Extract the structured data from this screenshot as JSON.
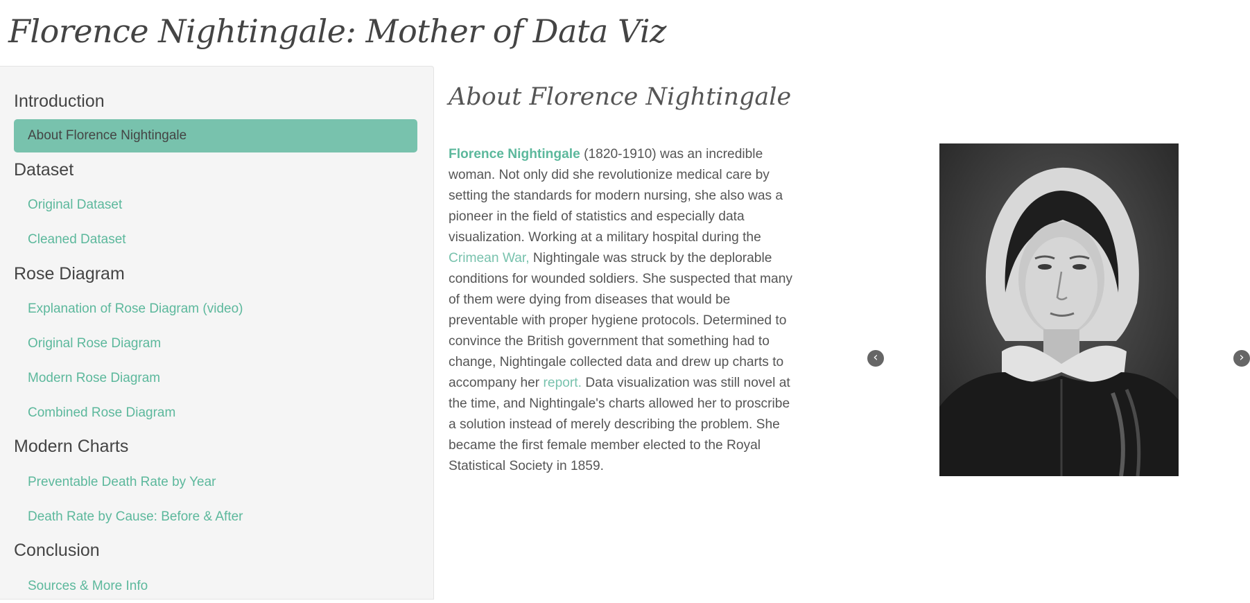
{
  "app_title": "Florence Nightingale: Mother of Data Viz",
  "sidebar": {
    "sections": [
      {
        "header": "Introduction",
        "items": [
          {
            "label": "About Florence Nightingale",
            "active": true
          }
        ]
      },
      {
        "header": "Dataset",
        "items": [
          {
            "label": "Original Dataset"
          },
          {
            "label": "Cleaned Dataset"
          }
        ]
      },
      {
        "header": "Rose Diagram",
        "items": [
          {
            "label": "Explanation of Rose Diagram (video)"
          },
          {
            "label": "Original Rose Diagram"
          },
          {
            "label": "Modern Rose Diagram"
          },
          {
            "label": "Combined Rose Diagram"
          }
        ]
      },
      {
        "header": "Modern Charts",
        "items": [
          {
            "label": "Preventable Death Rate by Year"
          },
          {
            "label": "Death Rate by Cause: Before & After"
          }
        ]
      },
      {
        "header": "Conclusion",
        "items": [
          {
            "label": "Sources & More Info"
          }
        ]
      }
    ]
  },
  "main": {
    "title": "About Florence Nightingale",
    "bio": {
      "link_name": "Florence Nightingale",
      "text1": " (1820-1910) was an incredible woman. Not only did she revolutionize medical care by setting the standards for modern nursing, she also was a pioneer in the field of statistics and especially data visualization. Working at a military hospital during the ",
      "link_war": "Crimean War,",
      "text2": " Nightingale was struck by the deplorable conditions for wounded soldiers. She suspected that many of them were dying from diseases that would be preventable with proper hygiene protocols. Determined to convince the British government that something had to change, Nightingale collected data and drew up charts to accompany her ",
      "link_report": "report.",
      "text3": " Data visualization was still novel at the time, and Nightingale's charts allowed her to proscribe a solution instead of merely describing the problem. She became the first female member elected to the Royal Statistical Society in 1859."
    },
    "carousel": {
      "prev_icon": "chevron-left-circle",
      "next_icon": "chevron-right-circle",
      "image": "portrait of Florence Nightingale"
    }
  },
  "colors": {
    "accent": "#78c2ad",
    "link": "#5cb89c",
    "text": "#555555",
    "sidebar_bg": "#f5f5f5"
  }
}
